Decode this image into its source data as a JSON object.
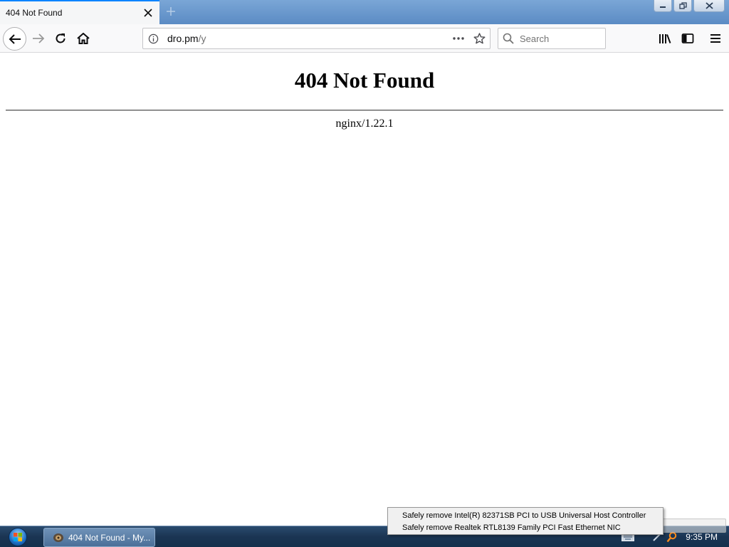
{
  "browser": {
    "tab": {
      "title": "404 Not Found"
    },
    "urlbar": {
      "domain": "dro.pm",
      "path": "/y"
    },
    "search": {
      "placeholder": "Search"
    }
  },
  "page": {
    "heading": "404 Not Found",
    "server_line": "nginx/1.22.1"
  },
  "taskbar": {
    "task_label": "404 Not Found - My...",
    "clock": "9:35 PM"
  },
  "popup_menu": {
    "items": [
      "Safely remove Intel(R) 82371SB PCI to USB Universal Host Controller",
      "Safely remove Realtek RTL8139 Family PCI Fast Ethernet NIC"
    ]
  },
  "colors": {
    "accent_tab": "#0a84ff",
    "taskbar": "#1b3553",
    "toolbar": "#f9f9fa"
  }
}
